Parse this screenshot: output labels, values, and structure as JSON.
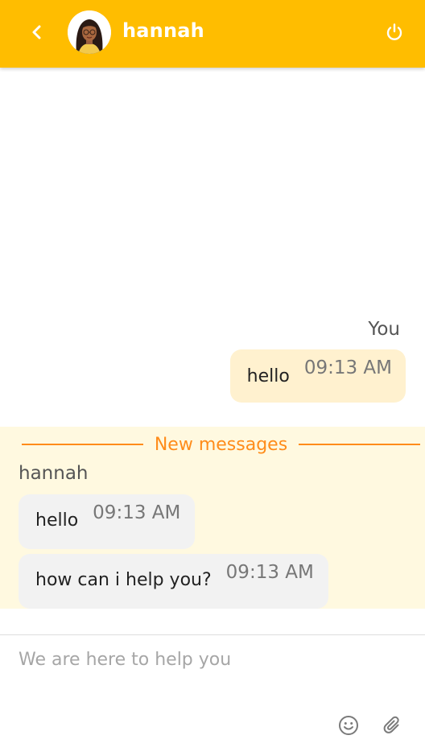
{
  "header": {
    "agent_name": "hannah",
    "back_icon": "chevron-left-icon",
    "power_icon": "power-icon",
    "accent_color": "#ffbd00"
  },
  "conversation": {
    "you_label": "You",
    "outgoing": [
      {
        "text": "hello",
        "time": "09:13 AM"
      }
    ],
    "new_messages_label": "New messages",
    "sender_name": "hannah",
    "incoming": [
      {
        "text": "hello",
        "time": "09:13 AM"
      },
      {
        "text": "how can i help you?",
        "time": "09:13 AM"
      }
    ]
  },
  "composer": {
    "placeholder": "We are here to help you",
    "value": "",
    "emoji_icon": "smiley-icon",
    "attach_icon": "paperclip-icon"
  },
  "colors": {
    "divider": "#ff8c1a",
    "new_messages_bg": "#fff9e0",
    "outgoing_bubble": "#fff1cf",
    "incoming_bubble": "#f2f2f2"
  }
}
